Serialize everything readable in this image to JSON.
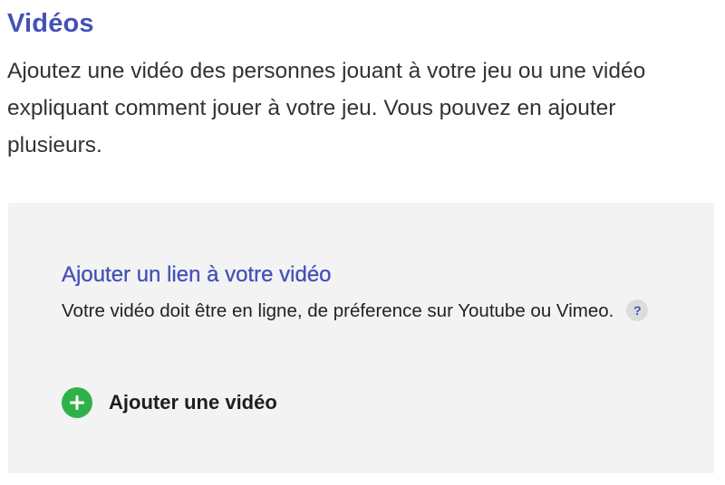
{
  "section": {
    "title": "Vidéos",
    "description": "Ajoutez une vidéo des personnes jouant à votre jeu ou une vidéo expliquant comment jouer à votre jeu. Vous pouvez en ajouter plusieurs."
  },
  "panel": {
    "title": "Ajouter un lien à votre vidéo",
    "description": "Votre vidéo doit être en ligne, de préference sur Youtube ou Vimeo.",
    "help_icon_text": "?",
    "add_button_label": "Ajouter une vidéo"
  },
  "colors": {
    "accent": "#4451b8",
    "add_green": "#2fb14a",
    "panel_bg": "#f3f3f3"
  },
  "icons": {
    "help": "question-circle-icon",
    "add": "plus-circle-icon"
  }
}
